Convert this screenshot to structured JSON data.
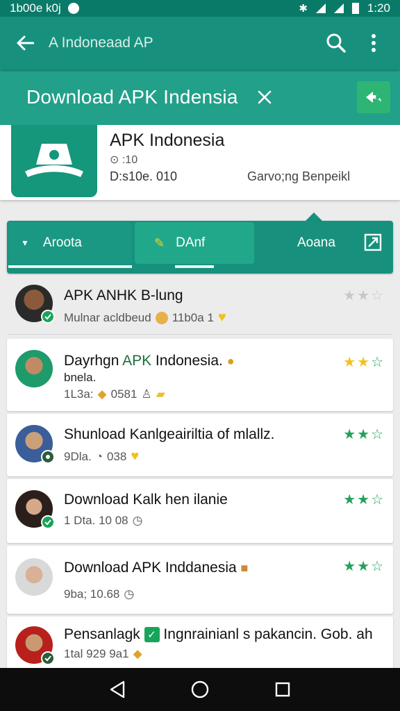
{
  "status_bar": {
    "time_left": "1b00e k0j",
    "time_right": "1:20"
  },
  "toolbar": {
    "search_text": "A Indoneaad AP"
  },
  "banner": {
    "title": "Download APK Indensia"
  },
  "app": {
    "name": "APK Indonesia",
    "meta": "⊙ :10",
    "size": "D:s10e. 010",
    "developer": "Garvo;ng Benpeikl"
  },
  "tabs": [
    {
      "label": "Aroota"
    },
    {
      "label": "DAnf"
    },
    {
      "label": "Aoana"
    }
  ],
  "results": [
    {
      "title": "APK ANHK B-lung",
      "sub": "Mulnar acldbeud",
      "sub2": "11b0a 1",
      "stars_on": 0,
      "star_style": "off"
    },
    {
      "title_a": "Dayrhgn ",
      "title_hl": "APK",
      "title_b": " Indonesia.",
      "title2": "bnela.",
      "sub": "1L3a:",
      "sub2": "0581",
      "stars_on": 2,
      "star_style": "gold"
    },
    {
      "title": "Shunload Kanlgeairiltia of mlallz.",
      "sub": "9Dla.",
      "sub2": "038",
      "stars_on": 2,
      "star_style": "green"
    },
    {
      "title": "Download Kalk hen ilanie",
      "sub": "1 Dta. 10 08",
      "sub2": "",
      "stars_on": 2,
      "star_style": "green"
    },
    {
      "title": "Download APK Inddanesia",
      "sub": "9ba;  10.68",
      "sub2": "",
      "stars_on": 2,
      "star_style": "green"
    },
    {
      "title_a": "Pensanlagk ",
      "title_b": " Ingnrainianl s pakancin. Gob. ah",
      "sub": "1tal  929 9a1",
      "sub2": "",
      "stars_on": 0,
      "star_style": "none"
    }
  ],
  "colors": {
    "primary": "#17917d",
    "banner": "#22a08a",
    "accent": "#2eb573",
    "star_green": "#23a25a",
    "star_gold": "#f2c01e"
  }
}
